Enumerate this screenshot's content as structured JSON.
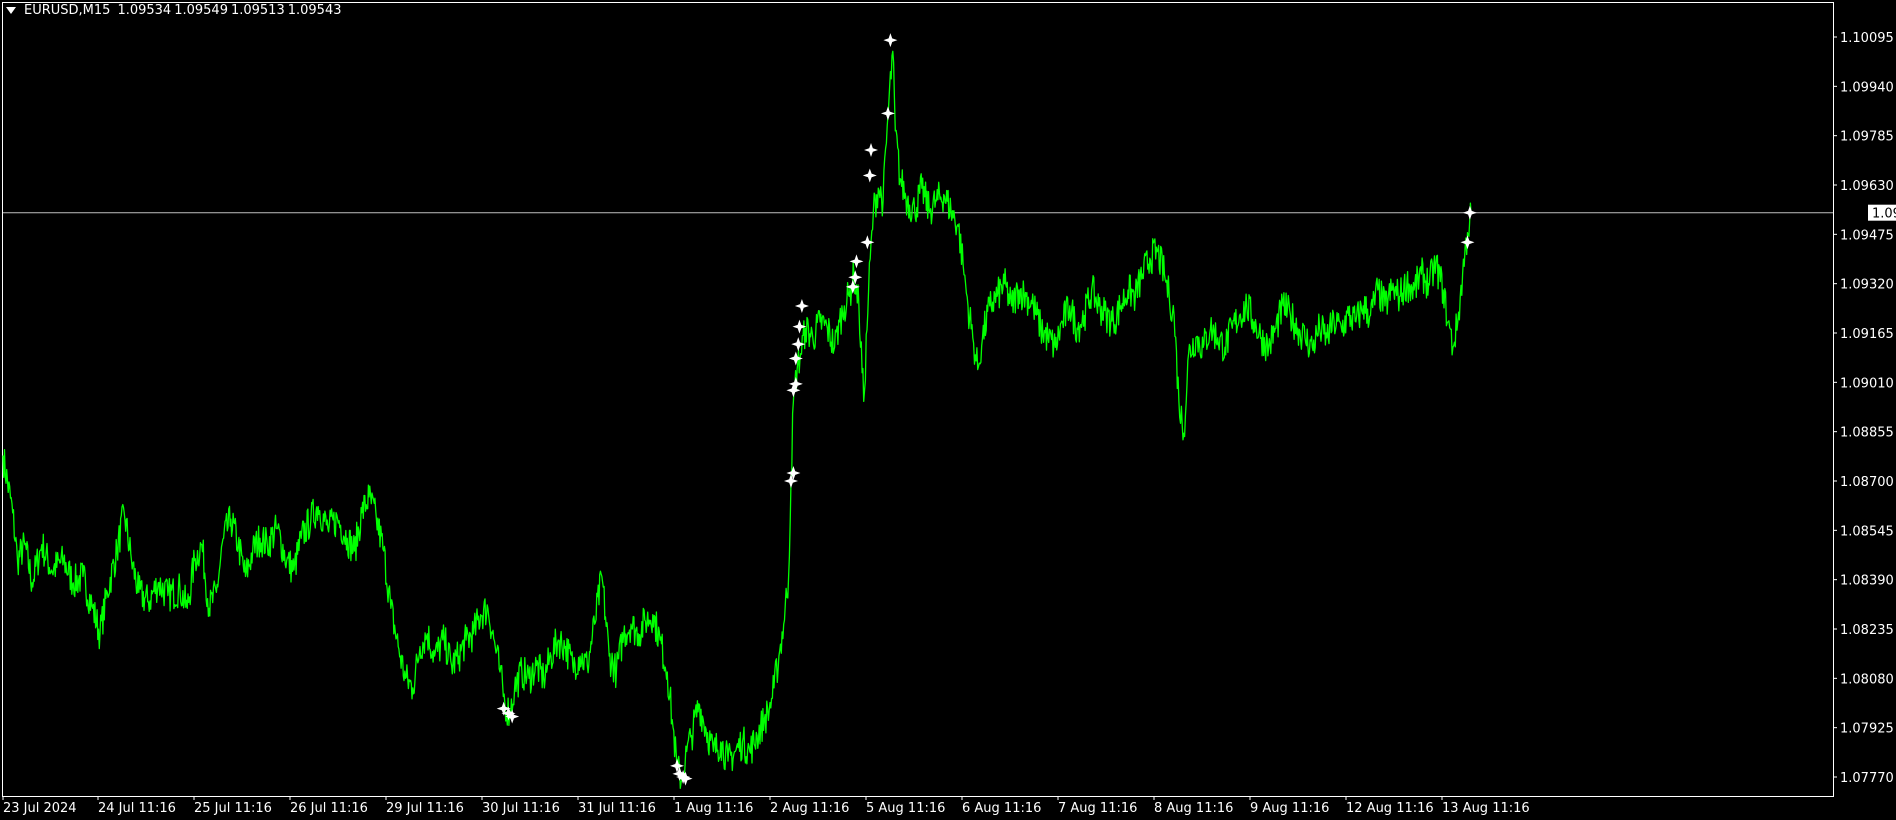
{
  "header": {
    "symbol_timeframe": "EURUSD,M15",
    "open": "1.09534",
    "high": "1.09549",
    "low": "1.09513",
    "close": "1.09543"
  },
  "colors": {
    "background": "#000000",
    "price_line": "#00ff00",
    "axis": "#ffffff",
    "signal_marker": "#ffffff",
    "bid_line": "#c0c0c0"
  },
  "chart_data": {
    "type": "line",
    "symbol": "EURUSD",
    "timeframe": "M15",
    "ylim": [
      1.077,
      1.101
    ],
    "y_ticks": [
      "1.10095",
      "1.09940",
      "1.09785",
      "1.09630",
      "1.09475",
      "1.09320",
      "1.09165",
      "1.09010",
      "1.08855",
      "1.08700",
      "1.08545",
      "1.08390",
      "1.08235",
      "1.08080",
      "1.07925",
      "1.07770"
    ],
    "x_ticks": [
      "23 Jul 2024",
      "24 Jul 11:16",
      "25 Jul 11:16",
      "26 Jul 11:16",
      "29 Jul 11:16",
      "30 Jul 11:16",
      "31 Jul 11:16",
      "1 Aug 11:16",
      "2 Aug 11:16",
      "5 Aug 11:16",
      "6 Aug 11:16",
      "7 Aug 11:16",
      "8 Aug 11:16",
      "9 Aug 11:16",
      "12 Aug 11:16",
      "13 Aug 11:16"
    ],
    "current_price": "1.09543",
    "current_price_value": 1.09543,
    "x_domain": [
      0,
      1512
    ],
    "series": [
      {
        "points": [
          [
            0,
            1.0878
          ],
          [
            8,
            1.086
          ],
          [
            12,
            1.0845
          ],
          [
            18,
            1.085
          ],
          [
            24,
            1.0838
          ],
          [
            32,
            1.085
          ],
          [
            40,
            1.0842
          ],
          [
            50,
            1.0845
          ],
          [
            58,
            1.0838
          ],
          [
            66,
            1.084
          ],
          [
            74,
            1.083
          ],
          [
            80,
            1.0822
          ],
          [
            86,
            1.0835
          ],
          [
            94,
            1.0848
          ],
          [
            100,
            1.086
          ],
          [
            106,
            1.0845
          ],
          [
            112,
            1.0835
          ],
          [
            120,
            1.0832
          ],
          [
            128,
            1.0838
          ],
          [
            136,
            1.0834
          ],
          [
            146,
            1.0836
          ],
          [
            152,
            1.083
          ],
          [
            158,
            1.0845
          ],
          [
            164,
            1.085
          ],
          [
            170,
            1.083
          ],
          [
            176,
            1.0835
          ],
          [
            182,
            1.0852
          ],
          [
            188,
            1.0858
          ],
          [
            194,
            1.085
          ],
          [
            200,
            1.084
          ],
          [
            206,
            1.0848
          ],
          [
            212,
            1.0852
          ],
          [
            218,
            1.085
          ],
          [
            226,
            1.0855
          ],
          [
            234,
            1.0845
          ],
          [
            240,
            1.0842
          ],
          [
            246,
            1.0852
          ],
          [
            254,
            1.0858
          ],
          [
            260,
            1.0862
          ],
          [
            268,
            1.0855
          ],
          [
            276,
            1.0858
          ],
          [
            284,
            1.0852
          ],
          [
            290,
            1.0848
          ],
          [
            296,
            1.086
          ],
          [
            302,
            1.0865
          ],
          [
            308,
            1.0858
          ],
          [
            314,
            1.0848
          ],
          [
            320,
            1.083
          ],
          [
            326,
            1.0818
          ],
          [
            332,
            1.0808
          ],
          [
            338,
            1.0805
          ],
          [
            344,
            1.0818
          ],
          [
            350,
            1.0822
          ],
          [
            356,
            1.0815
          ],
          [
            364,
            1.082
          ],
          [
            370,
            1.0812
          ],
          [
            376,
            1.0815
          ],
          [
            382,
            1.082
          ],
          [
            388,
            1.0822
          ],
          [
            394,
            1.0828
          ],
          [
            400,
            1.083
          ],
          [
            406,
            1.0818
          ],
          [
            410,
            1.081
          ],
          [
            414,
            1.08
          ],
          [
            418,
            1.0797
          ],
          [
            422,
            1.0805
          ],
          [
            428,
            1.081
          ],
          [
            434,
            1.0808
          ],
          [
            440,
            1.0812
          ],
          [
            446,
            1.0808
          ],
          [
            452,
            1.0815
          ],
          [
            458,
            1.082
          ],
          [
            464,
            1.0818
          ],
          [
            470,
            1.0812
          ],
          [
            476,
            1.0815
          ],
          [
            482,
            1.0812
          ],
          [
            488,
            1.0825
          ],
          [
            494,
            1.084
          ],
          [
            500,
            1.0815
          ],
          [
            506,
            1.081
          ],
          [
            512,
            1.0822
          ],
          [
            518,
            1.0825
          ],
          [
            524,
            1.0822
          ],
          [
            530,
            1.0826
          ],
          [
            536,
            1.0828
          ],
          [
            542,
            1.082
          ],
          [
            548,
            1.081
          ],
          [
            552,
            1.0795
          ],
          [
            556,
            1.078
          ],
          [
            560,
            1.0776
          ],
          [
            564,
            1.0785
          ],
          [
            568,
            1.079
          ],
          [
            574,
            1.08
          ],
          [
            580,
            1.0792
          ],
          [
            586,
            1.0785
          ],
          [
            592,
            1.0788
          ],
          [
            598,
            1.0782
          ],
          [
            604,
            1.0785
          ],
          [
            610,
            1.0788
          ],
          [
            616,
            1.0785
          ],
          [
            622,
            1.079
          ],
          [
            628,
            1.0795
          ],
          [
            632,
            1.0798
          ],
          [
            636,
            1.0805
          ],
          [
            640,
            1.0815
          ],
          [
            644,
            1.0825
          ],
          [
            648,
            1.084
          ],
          [
            650,
            1.087
          ],
          [
            652,
            1.0895
          ],
          [
            655,
            1.0905
          ],
          [
            658,
            1.091
          ],
          [
            662,
            1.0918
          ],
          [
            668,
            1.0915
          ],
          [
            674,
            1.092
          ],
          [
            680,
            1.0918
          ],
          [
            686,
            1.0912
          ],
          [
            690,
            1.092
          ],
          [
            694,
            1.0925
          ],
          [
            698,
            1.0928
          ],
          [
            702,
            1.0935
          ],
          [
            706,
            1.0925
          ],
          [
            710,
            1.0895
          ],
          [
            714,
            1.093
          ],
          [
            718,
            1.0955
          ],
          [
            722,
            1.0962
          ],
          [
            726,
            1.0958
          ],
          [
            730,
            1.0985
          ],
          [
            734,
            1.1005
          ],
          [
            736,
            1.098
          ],
          [
            740,
            1.0965
          ],
          [
            746,
            1.0958
          ],
          [
            752,
            1.0955
          ],
          [
            758,
            1.0962
          ],
          [
            764,
            1.0955
          ],
          [
            770,
            1.0958
          ],
          [
            776,
            1.096
          ],
          [
            782,
            1.0955
          ],
          [
            788,
            1.095
          ],
          [
            792,
            1.0938
          ],
          [
            796,
            1.0925
          ],
          [
            800,
            1.0915
          ],
          [
            804,
            1.0905
          ],
          [
            808,
            1.0915
          ],
          [
            814,
            1.0925
          ],
          [
            820,
            1.0928
          ],
          [
            826,
            1.0932
          ],
          [
            832,
            1.0925
          ],
          [
            838,
            1.093
          ],
          [
            844,
            1.0928
          ],
          [
            850,
            1.0925
          ],
          [
            856,
            1.0918
          ],
          [
            862,
            1.0915
          ],
          [
            868,
            1.0912
          ],
          [
            874,
            1.092
          ],
          [
            880,
            1.0925
          ],
          [
            886,
            1.0918
          ],
          [
            892,
            1.0922
          ],
          [
            898,
            1.093
          ],
          [
            904,
            1.0925
          ],
          [
            910,
            1.0922
          ],
          [
            916,
            1.092
          ],
          [
            922,
            1.0925
          ],
          [
            928,
            1.093
          ],
          [
            934,
            1.0928
          ],
          [
            940,
            1.0935
          ],
          [
            946,
            1.094
          ],
          [
            952,
            1.0942
          ],
          [
            958,
            1.0935
          ],
          [
            962,
            1.0928
          ],
          [
            966,
            1.0922
          ],
          [
            970,
            1.0895
          ],
          [
            974,
            1.0885
          ],
          [
            978,
            1.091
          ],
          [
            984,
            1.0915
          ],
          [
            990,
            1.0912
          ],
          [
            996,
            1.0918
          ],
          [
            1002,
            1.0915
          ],
          [
            1008,
            1.0912
          ],
          [
            1014,
            1.0918
          ],
          [
            1020,
            1.0922
          ],
          [
            1026,
            1.0925
          ],
          [
            1032,
            1.092
          ],
          [
            1038,
            1.0915
          ],
          [
            1044,
            1.0912
          ],
          [
            1050,
            1.0918
          ],
          [
            1056,
            1.0925
          ],
          [
            1062,
            1.0922
          ],
          [
            1068,
            1.0918
          ],
          [
            1074,
            1.0915
          ],
          [
            1080,
            1.0912
          ],
          [
            1086,
            1.0918
          ],
          [
            1092,
            1.0915
          ],
          [
            1098,
            1.092
          ],
          [
            1104,
            1.0918
          ],
          [
            1110,
            1.0922
          ],
          [
            1116,
            1.092
          ],
          [
            1122,
            1.0925
          ],
          [
            1128,
            1.0922
          ],
          [
            1134,
            1.093
          ],
          [
            1140,
            1.0925
          ],
          [
            1146,
            1.093
          ],
          [
            1152,
            1.0928
          ],
          [
            1158,
            1.0932
          ],
          [
            1164,
            1.093
          ],
          [
            1170,
            1.0935
          ],
          [
            1176,
            1.0932
          ],
          [
            1182,
            1.0938
          ],
          [
            1188,
            1.093
          ],
          [
            1192,
            1.092
          ],
          [
            1196,
            1.0912
          ],
          [
            1200,
            1.092
          ],
          [
            1204,
            1.0935
          ],
          [
            1208,
            1.0948
          ],
          [
            1211,
            1.0954
          ]
        ]
      }
    ],
    "signals": [
      [
        413,
        1.07985
      ],
      [
        417,
        1.0797
      ],
      [
        420,
        1.0796
      ],
      [
        556,
        1.07805
      ],
      [
        558,
        1.0778
      ],
      [
        561,
        1.0777
      ],
      [
        563,
        1.07765
      ],
      [
        650,
        1.087
      ],
      [
        652,
        1.08725
      ],
      [
        652,
        1.08985
      ],
      [
        654,
        1.09005
      ],
      [
        654,
        1.09085
      ],
      [
        656,
        1.0913
      ],
      [
        657,
        1.09185
      ],
      [
        659,
        1.0925
      ],
      [
        701,
        1.0931
      ],
      [
        703,
        1.0934
      ],
      [
        704,
        1.0939
      ],
      [
        713,
        1.0945
      ],
      [
        715,
        1.0966
      ],
      [
        716,
        1.0974
      ],
      [
        730,
        1.09855
      ],
      [
        732,
        1.10085
      ],
      [
        1208,
        1.0945
      ],
      [
        1210,
        1.09543
      ]
    ]
  }
}
